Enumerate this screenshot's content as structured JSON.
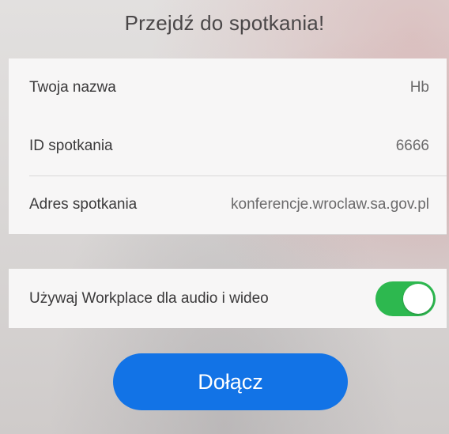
{
  "header": {
    "title": "Przejdź do spotkania!"
  },
  "fields": [
    {
      "label": "Twoja nazwa",
      "value": "Hb"
    },
    {
      "label": "ID spotkania",
      "value": "6666"
    },
    {
      "label": "Adres spotkania",
      "value": "konferencje.wroclaw.sa.gov.pl"
    }
  ],
  "audio_toggle": {
    "label": "Używaj Workplace dla audio i wideo",
    "on": true,
    "color": "#2db84f"
  },
  "join_button": {
    "label": "Dołącz",
    "color": "#1273e6"
  }
}
